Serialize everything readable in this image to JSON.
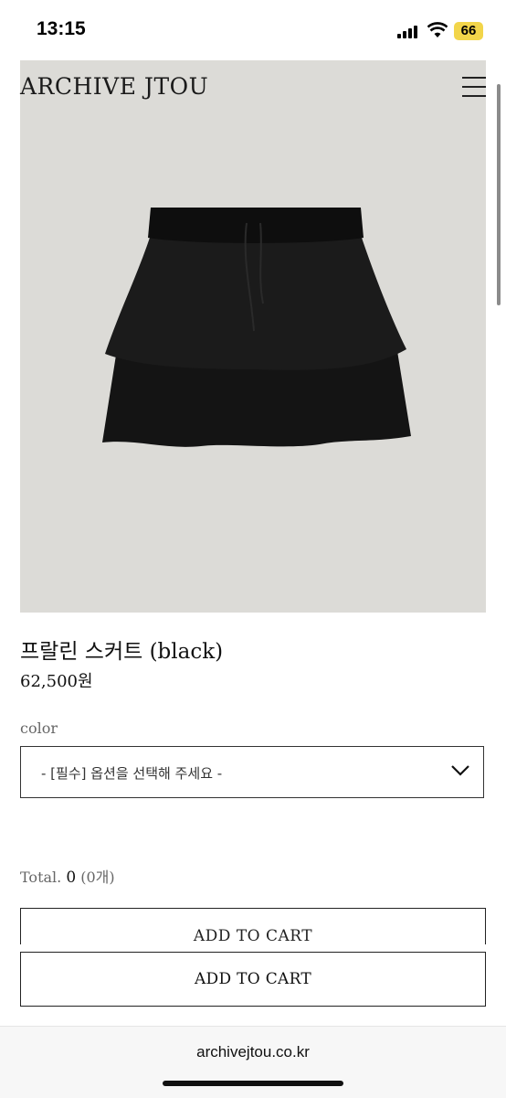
{
  "status_bar": {
    "time": "13:15",
    "battery_level": "66",
    "battery_color": "#f2d54a"
  },
  "header": {
    "logo": "ARCHIVE JTOU",
    "menu_icon": "hamburger-menu-icon"
  },
  "product": {
    "image_bg": "#dcdbd7",
    "title": "프랄린 스커트 (black)",
    "price": "62,500원"
  },
  "options": {
    "label": "color",
    "select_value": "- [필수] 옵션을 선택해 주세요 -"
  },
  "total": {
    "label": "Total.",
    "amount": "0",
    "count": "(0개)"
  },
  "buttons": {
    "partial_label": "ADD TO CART",
    "add_to_cart": "ADD TO CART"
  },
  "browser": {
    "url": "archivejtou.co.kr"
  }
}
